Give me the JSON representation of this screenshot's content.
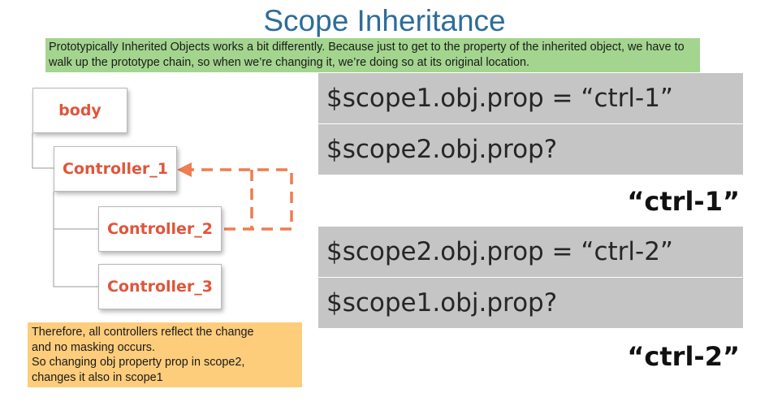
{
  "title": "Scope Inheritance",
  "intro": "Prototypically Inherited Objects works a bit differently. Because just to get to the property of the inherited object, we have to walk up the prototype chain, so when we’re changing it, we’re doing so at its original location.",
  "tree": {
    "body": "body",
    "controller_1": "Controller_1",
    "controller_2": "Controller_2",
    "controller_3": "Controller_3"
  },
  "examples": [
    {
      "assignment": "$scope1.obj.prop = “ctrl-1”",
      "question": "$scope2.obj.prop?",
      "answer": "“ctrl-1”"
    },
    {
      "assignment": "$scope2.obj.prop = “ctrl-2”",
      "question": "$scope1.obj.prop?",
      "answer": "“ctrl-2”"
    }
  ],
  "note": {
    "lines": [
      "Therefore, all controllers reflect the change",
      "and no masking occurs.",
      "So changing obj property prop in scope2,",
      "changes it also in scope1"
    ]
  },
  "colors": {
    "title": "#2d6d9b",
    "intro_bg": "#a3d58f",
    "note_bg": "#fdcd7c",
    "node_text": "#e0553a",
    "arrow": "#ee7d4f",
    "code_box": "#c5c5c5"
  }
}
